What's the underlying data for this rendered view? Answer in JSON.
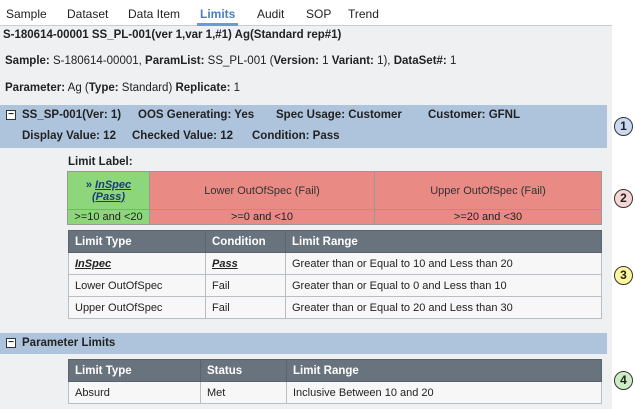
{
  "tabs": [
    "Sample",
    "Dataset",
    "Data Item",
    "Limits",
    "Audit",
    "SOP",
    "Trend"
  ],
  "active_tab": "Limits",
  "header": {
    "title": "S-180614-00001 SS_PL-001(ver 1,var 1,#1) Ag(Standard rep#1)",
    "sample_label": "Sample:",
    "sample_value": " S-180614-00001, ",
    "paramlist_label": "ParamList:",
    "paramlist_value": " SS_PL-001 (",
    "version_label": "Version:",
    "version_value": " 1 ",
    "variant_label": "Variant:",
    "variant_value": " 1), ",
    "dataset_label": "DataSet#:",
    "dataset_value": " 1",
    "parameter_label": "Parameter:",
    "parameter_value": " Ag (",
    "type_label": "Type:",
    "type_value": " Standard) ",
    "replicate_label": "Replicate:",
    "replicate_value": " 1"
  },
  "spec": {
    "toggle": "−",
    "name": "SS_SP-001(Ver: 1)",
    "oos": "OOS Generating: Yes",
    "usage": "Spec Usage: Customer",
    "customer": "Customer: GFNL",
    "display": "Display Value: 12",
    "checked": "Checked Value: 12",
    "condition": "Condition: Pass"
  },
  "limit_label": {
    "title": "Limit Label:",
    "arrow": "»",
    "inspec": "InSpec",
    "pass": "(Pass)",
    "lower": "Lower OutOfSpec (Fail)",
    "upper": "Upper OutOfSpec (Fail)",
    "range_inspec": ">=10 and <20",
    "range_lower": ">=0 and <10",
    "range_upper": ">=20 and <30"
  },
  "limits_table": {
    "headers": [
      "Limit Type",
      "Condition",
      "Limit Range"
    ],
    "rows": [
      [
        "InSpec",
        "Pass",
        "Greater than or Equal to 10 and Less than 20"
      ],
      [
        "Lower OutOfSpec",
        "Fail",
        "Greater than or Equal to 0 and Less than 10"
      ],
      [
        "Upper OutOfSpec",
        "Fail",
        "Greater than or Equal to 20 and Less than 30"
      ]
    ]
  },
  "parameter_limits": {
    "toggle": "−",
    "title": "Parameter Limits",
    "headers": [
      "Limit Type",
      "Status",
      "Limit Range"
    ],
    "rows": [
      [
        "Absurd",
        "Met",
        "Inclusive Between 10 and 20"
      ]
    ]
  },
  "callouts": [
    "1",
    "2",
    "3",
    "4"
  ],
  "colors": {
    "band": "#aec4dd",
    "pass": "#8ed67a",
    "fail": "#e98a84",
    "grid_header": "#68737e",
    "callout_1": "#c9d9f2",
    "callout_2": "#f6d6d4",
    "callout_3": "#fff59a",
    "callout_4": "#cdeec4"
  }
}
